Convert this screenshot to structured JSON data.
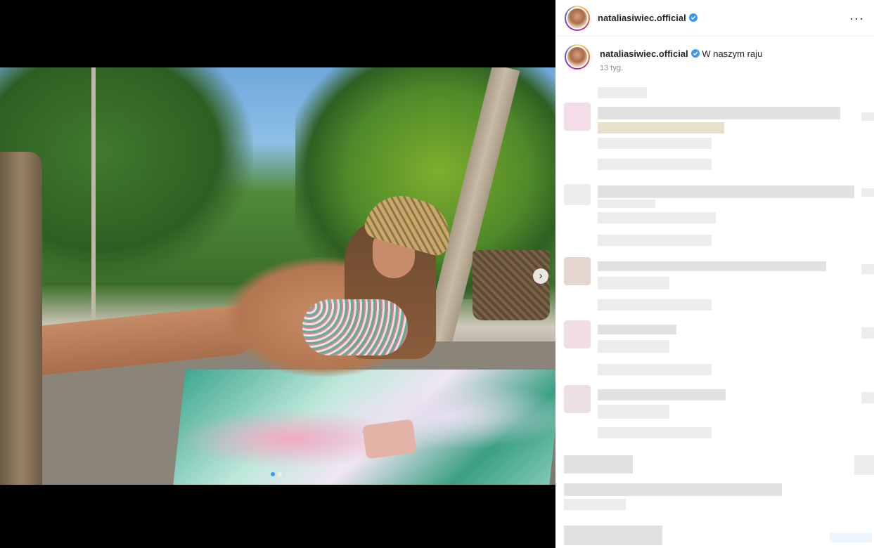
{
  "post": {
    "username": "nataliasiwiec.official",
    "more_label": "···",
    "next_label": "›"
  },
  "caption": {
    "username": "nataliasiwiec.official",
    "text": "W naszym raju",
    "time": "13 tyg."
  },
  "carousel": {
    "count": 2,
    "active": 0
  },
  "colors": {
    "verified": "#3897f0",
    "username": "#262626",
    "meta": "#8e8e8e"
  },
  "icons": [
    "verified-icon",
    "more-icon",
    "chevron-right-icon"
  ]
}
